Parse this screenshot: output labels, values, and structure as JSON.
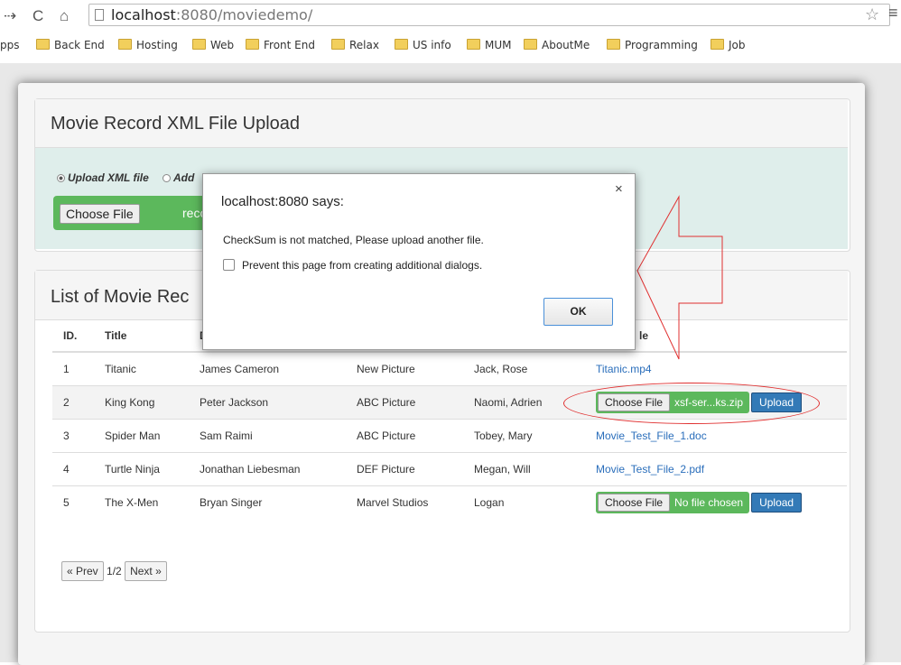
{
  "browser": {
    "url_host": "localhost",
    "url_rest": ":8080/moviedemo/",
    "bookmarks_label": "pps",
    "bookmarks": [
      "Back End",
      "Hosting",
      "Web",
      "Front End",
      "Relax",
      "US info",
      "MUM",
      "AboutMe",
      "Programming",
      "Job"
    ]
  },
  "upload_panel": {
    "title": "Movie Record XML File Upload",
    "radio_upload": "Upload XML file",
    "radio_add": "Add",
    "choose_label": "Choose File",
    "file_name": "record"
  },
  "list_panel": {
    "title": "List of Movie Rec",
    "headers": [
      "ID.",
      "Title",
      "D",
      "",
      "",
      "le"
    ],
    "rows": [
      {
        "id": "1",
        "title": "Titanic",
        "director": "James Cameron",
        "studio": "New Picture",
        "cast": "Jack, Rose",
        "file": "Titanic.mp4"
      },
      {
        "id": "2",
        "title": "King Kong",
        "director": "Peter Jackson",
        "studio": "ABC Picture",
        "cast": "Naomi, Adrien",
        "choose": "Choose File",
        "chosen": "xsf-ser...ks.zip",
        "upload": "Upload"
      },
      {
        "id": "3",
        "title": "Spider Man",
        "director": "Sam Raimi",
        "studio": "ABC Picture",
        "cast": "Tobey, Mary",
        "file": "Movie_Test_File_1.doc"
      },
      {
        "id": "4",
        "title": "Turtle Ninja",
        "director": "Jonathan Liebesman",
        "studio": "DEF Picture",
        "cast": "Megan, Will",
        "file": "Movie_Test_File_2.pdf"
      },
      {
        "id": "5",
        "title": "The X-Men",
        "director": "Bryan Singer",
        "studio": "Marvel Studios",
        "cast": "Logan",
        "choose": "Choose File",
        "chosen": "No file chosen",
        "upload": "Upload"
      }
    ],
    "pager": {
      "prev": "« Prev",
      "page": "1/2",
      "next": "Next »"
    }
  },
  "dialog": {
    "title": "localhost:8080 says:",
    "close": "×",
    "message": "CheckSum is not matched, Please upload another file.",
    "checkbox_label": "Prevent this page from creating additional dialogs.",
    "ok": "OK"
  },
  "colors": {
    "green": "#5cb85c",
    "blue": "#337ab7",
    "annotation_red": "#e03030"
  }
}
